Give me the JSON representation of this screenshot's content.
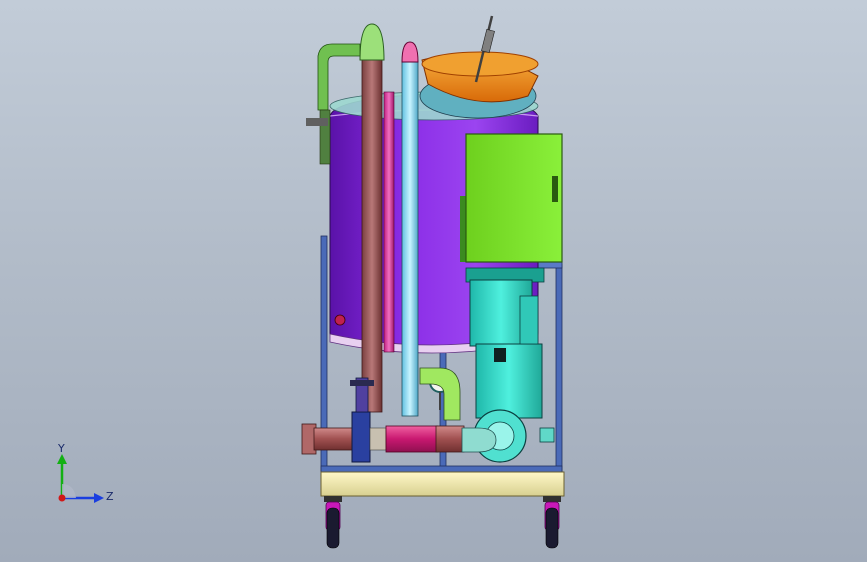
{
  "triad": {
    "y_label": "Y",
    "z_label": "Z",
    "colors": {
      "y": "#13b013",
      "z": "#1a3ee0",
      "x": "#d01818"
    }
  },
  "model_colors": {
    "tank_body": "#7a1fd6",
    "control_box": "#7ee12a",
    "pump": "#2fd3c3",
    "lid": "#f08a18",
    "frame": "#4a6ab8",
    "base": "#f2ecb0",
    "pipe_brown": "#b06060",
    "pipe_magenta": "#d0207a",
    "pipe_cyan": "#7fd8f0",
    "pipe_green": "#8fdc5e",
    "casters": "#d020c0"
  }
}
